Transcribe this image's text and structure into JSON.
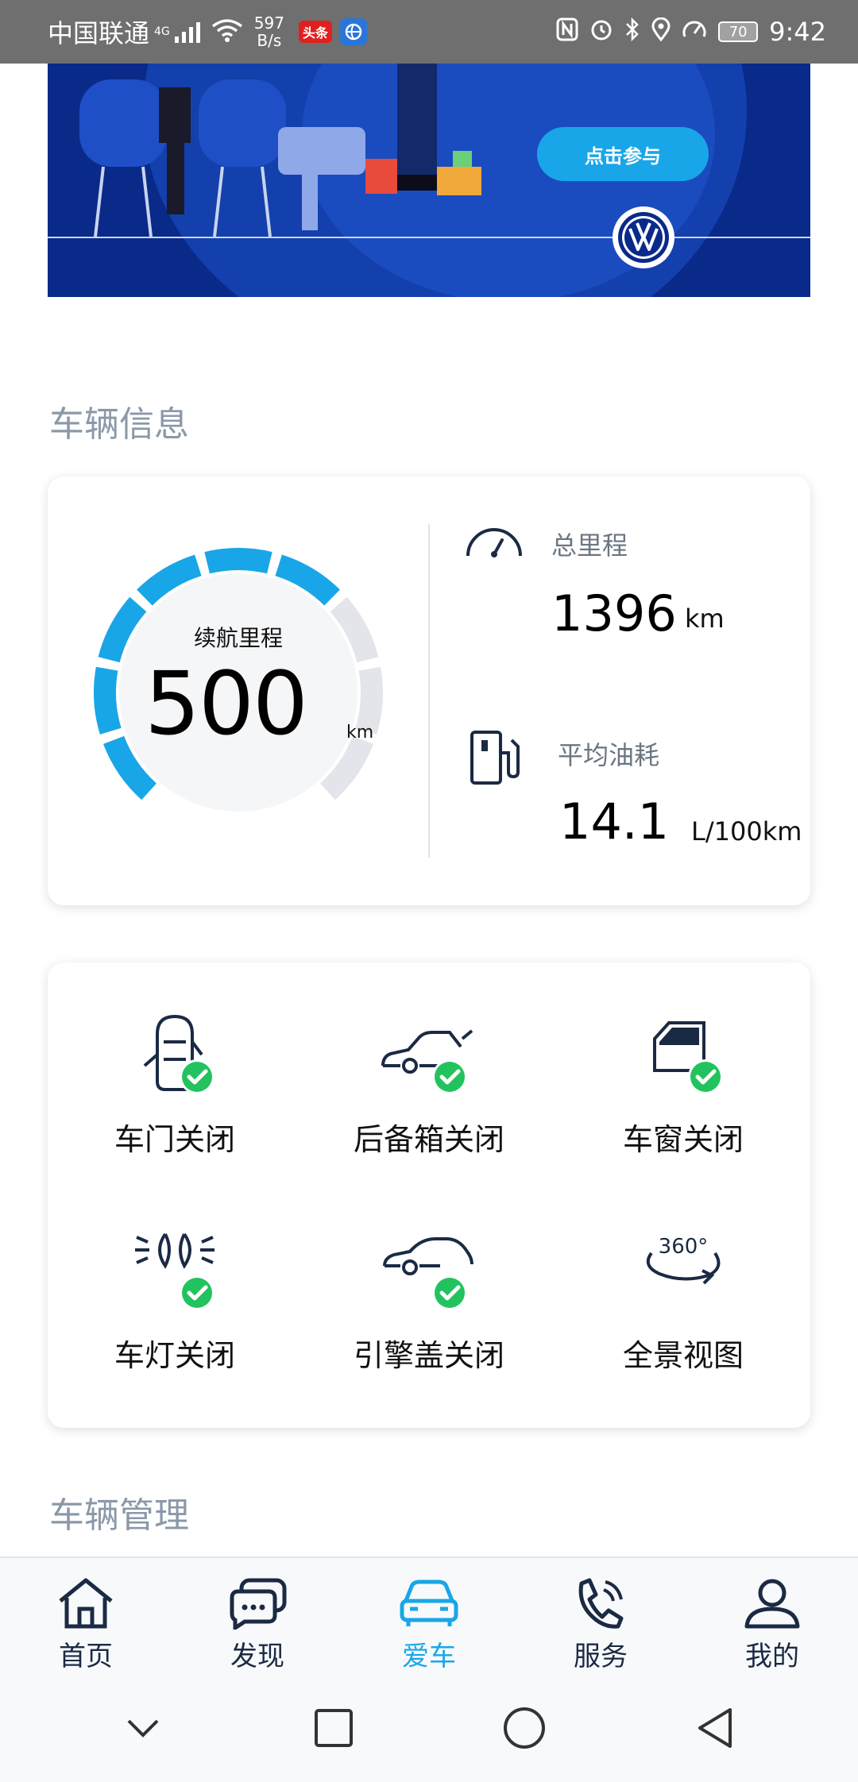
{
  "status_bar": {
    "carrier": "中国联通",
    "network": "4G",
    "speed_value": "597",
    "speed_unit": "B/s",
    "app_badge": "头条",
    "battery": "70",
    "time": "9:42"
  },
  "banner": {
    "cta_label": "点击参与"
  },
  "vehicle_info": {
    "title": "车辆信息",
    "range_label": "续航里程",
    "range_value": "500",
    "range_unit": "km",
    "range_fraction": 0.62,
    "odometer_label": "总里程",
    "odometer_value": "1396",
    "odometer_unit": "km",
    "fuel_label": "平均油耗",
    "fuel_value": "14.1",
    "fuel_unit": "L/100km"
  },
  "vehicle_status": {
    "items": [
      {
        "label": "车门关闭",
        "icon": "car-door-icon",
        "ok": true
      },
      {
        "label": "后备箱关闭",
        "icon": "trunk-icon",
        "ok": true
      },
      {
        "label": "车窗关闭",
        "icon": "window-icon",
        "ok": true
      },
      {
        "label": "车灯关闭",
        "icon": "headlight-icon",
        "ok": true
      },
      {
        "label": "引擎盖关闭",
        "icon": "hood-icon",
        "ok": true
      },
      {
        "label": "全景视图",
        "icon": "360-view-icon",
        "ok": false
      }
    ],
    "view_360_text": "360°"
  },
  "vehicle_management": {
    "title": "车辆管理"
  },
  "bottom_nav": {
    "items": [
      {
        "label": "首页",
        "icon": "home-icon"
      },
      {
        "label": "发现",
        "icon": "chat-icon"
      },
      {
        "label": "爱车",
        "icon": "car-icon",
        "active": true
      },
      {
        "label": "服务",
        "icon": "phone-icon"
      },
      {
        "label": "我的",
        "icon": "profile-icon"
      }
    ]
  },
  "colors": {
    "accent": "#19a6e8",
    "navy": "#1b2a44",
    "check_green": "#22c35e",
    "gauge_inactive": "#e3e5ea",
    "section_title": "#8a98a8"
  }
}
